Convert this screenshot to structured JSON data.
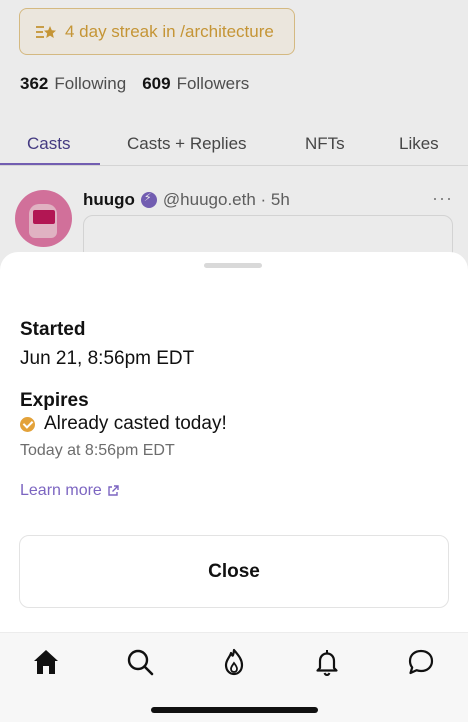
{
  "profile": {
    "streak_text": "4 day streak in /architecture",
    "following_count": "362",
    "following_label": "Following",
    "followers_count": "609",
    "followers_label": "Followers"
  },
  "tabs": [
    {
      "label": "Casts",
      "active": true
    },
    {
      "label": "Casts + Replies",
      "active": false
    },
    {
      "label": "NFTs",
      "active": false
    },
    {
      "label": "Likes",
      "active": false
    }
  ],
  "post": {
    "author_name": "huugo",
    "handle_time": "@huugo.eth · 5h",
    "more_label": "···"
  },
  "sheet": {
    "started_label": "Started",
    "started_value": "Jun 21, 8:56pm EDT",
    "expires_label": "Expires",
    "casted_text": "Already casted today!",
    "today_at": "Today at 8:56pm EDT",
    "learn_more": "Learn more",
    "close_label": "Close"
  },
  "bottom_nav": [
    "home-icon",
    "search-icon",
    "flame-icon",
    "bell-icon",
    "chat-icon"
  ],
  "colors": {
    "accent": "#7c65c1",
    "streak": "#d6a23b",
    "check": "#e3a23a"
  }
}
